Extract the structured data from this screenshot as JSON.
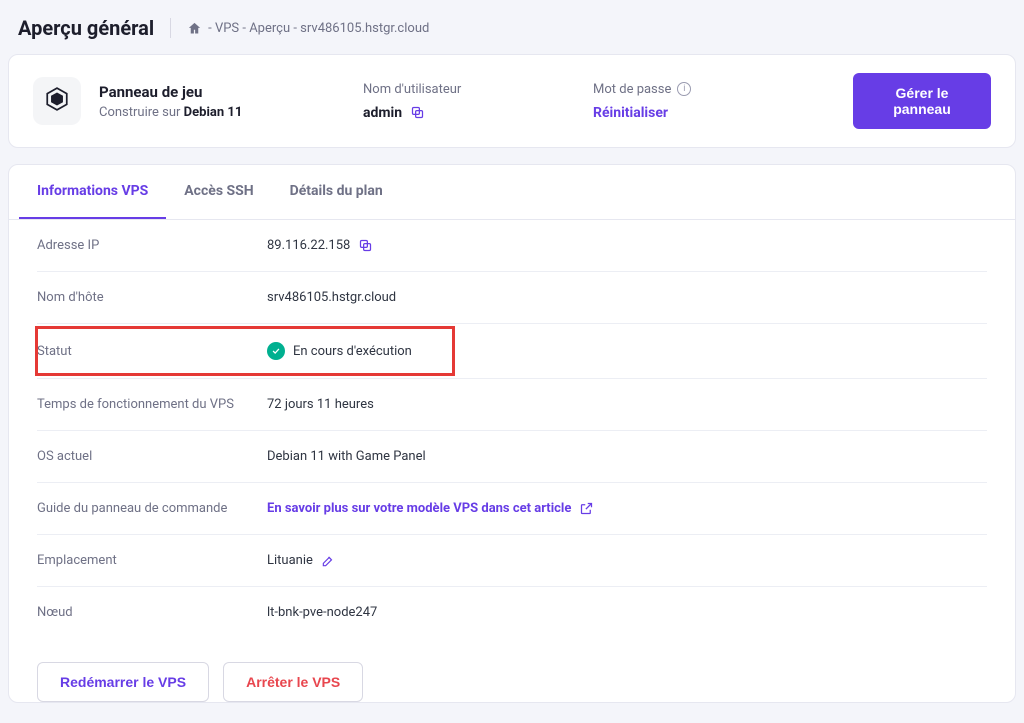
{
  "header": {
    "title": "Aperçu général",
    "breadcrumb": "- VPS - Aperçu - srv486105.hstgr.cloud"
  },
  "panel": {
    "title": "Panneau de jeu",
    "subtitle_prefix": "Construire sur ",
    "subtitle_bold": "Debian 11",
    "username_label": "Nom d'utilisateur",
    "username_value": "admin",
    "password_label": "Mot de passe",
    "password_action": "Réinitialiser",
    "manage_button": "Gérer le panneau"
  },
  "tabs": {
    "t0": "Informations VPS",
    "t1": "Accès SSH",
    "t2": "Détails du plan"
  },
  "info": {
    "ip_label": "Adresse IP",
    "ip_value": "89.116.22.158",
    "host_label": "Nom d'hôte",
    "host_value": "srv486105.hstgr.cloud",
    "status_label": "Statut",
    "status_value": "En cours d'exécution",
    "uptime_label": "Temps de fonctionnement du VPS",
    "uptime_value": "72 jours 11 heures",
    "os_label": "OS actuel",
    "os_value": "Debian 11 with Game Panel",
    "guide_label": "Guide du panneau de commande",
    "guide_link": "En savoir plus sur votre modèle VPS dans cet article",
    "location_label": "Emplacement",
    "location_value": "Lituanie",
    "node_label": "Nœud",
    "node_value": "lt-bnk-pve-node247"
  },
  "actions": {
    "restart": "Redémarrer le VPS",
    "stop": "Arrêter le VPS"
  },
  "colors": {
    "accent": "#673de6",
    "success": "#00b090",
    "danger": "#e8464e",
    "highlight": "#e53935"
  }
}
